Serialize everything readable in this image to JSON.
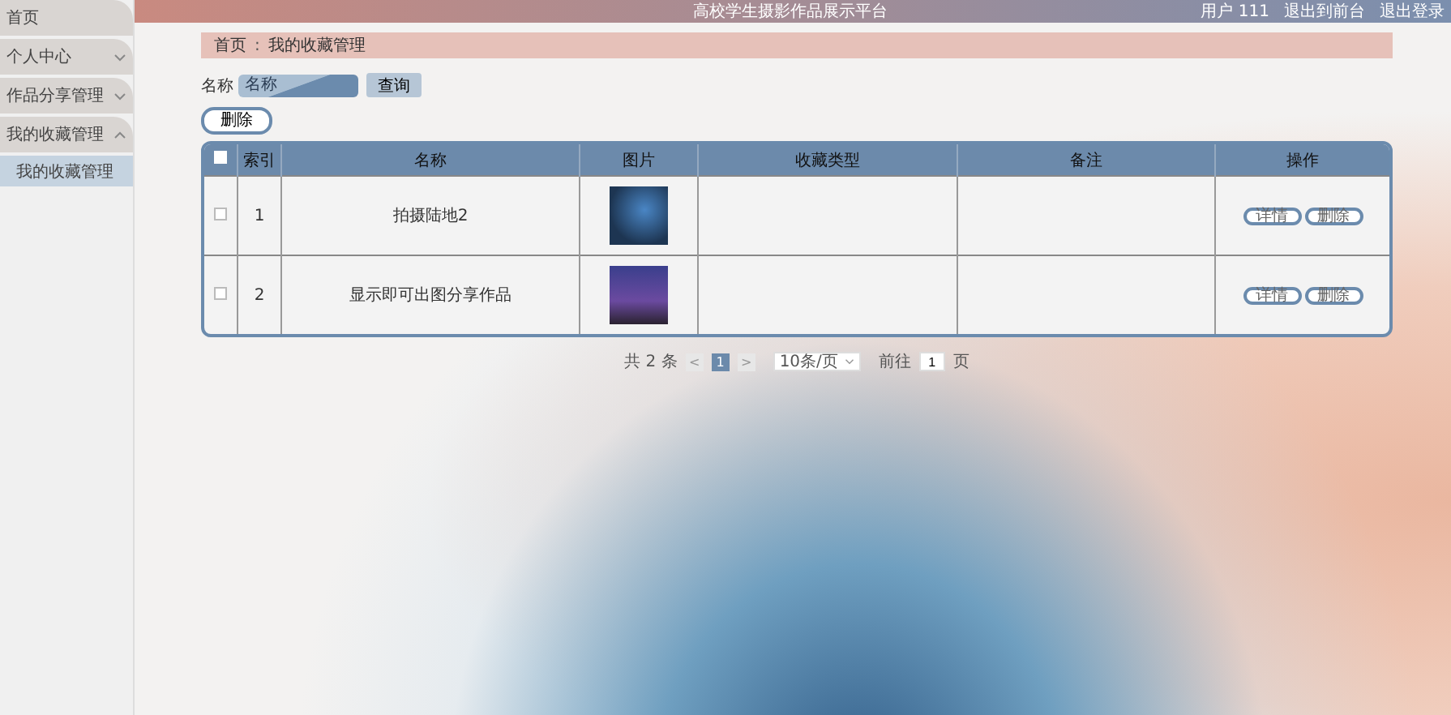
{
  "header": {
    "title": "高校学生摄影作品展示平台",
    "user": "用户 111",
    "links": [
      "退出到前台",
      "退出登录"
    ]
  },
  "sidebar": {
    "items": [
      {
        "label": "首页"
      },
      {
        "label": "个人中心",
        "expanded": false
      },
      {
        "label": "作品分享管理",
        "expanded": false
      },
      {
        "label": "我的收藏管理",
        "expanded": true,
        "children": [
          {
            "label": "我的收藏管理",
            "selected": true
          }
        ]
      }
    ]
  },
  "breadcrumb": {
    "separator": ":",
    "items": [
      "首页",
      "我的收藏管理"
    ]
  },
  "search": {
    "label": "名称",
    "placeholder": "名称",
    "button": "查询"
  },
  "delete_button": "删除",
  "table": {
    "all_checked": false,
    "columns": [
      "索引",
      "名称",
      "图片",
      "收藏类型",
      "备注",
      "操作"
    ],
    "rows": [
      {
        "checked": false,
        "index": "1",
        "name": "拍摄陆地2",
        "actions": [
          "详情",
          "删除"
        ]
      },
      {
        "checked": false,
        "index": "2",
        "name": "显示即可出图分享作品",
        "actions": [
          "详情",
          "删除"
        ]
      }
    ]
  },
  "pagination": {
    "total": "共 2 条",
    "prev": "<",
    "pages": [
      {
        "label": "1",
        "selected": true
      }
    ],
    "next": ">",
    "page_size": "10条/页",
    "goto_label": "前往",
    "goto_value": "1",
    "goto_suffix": "页"
  }
}
